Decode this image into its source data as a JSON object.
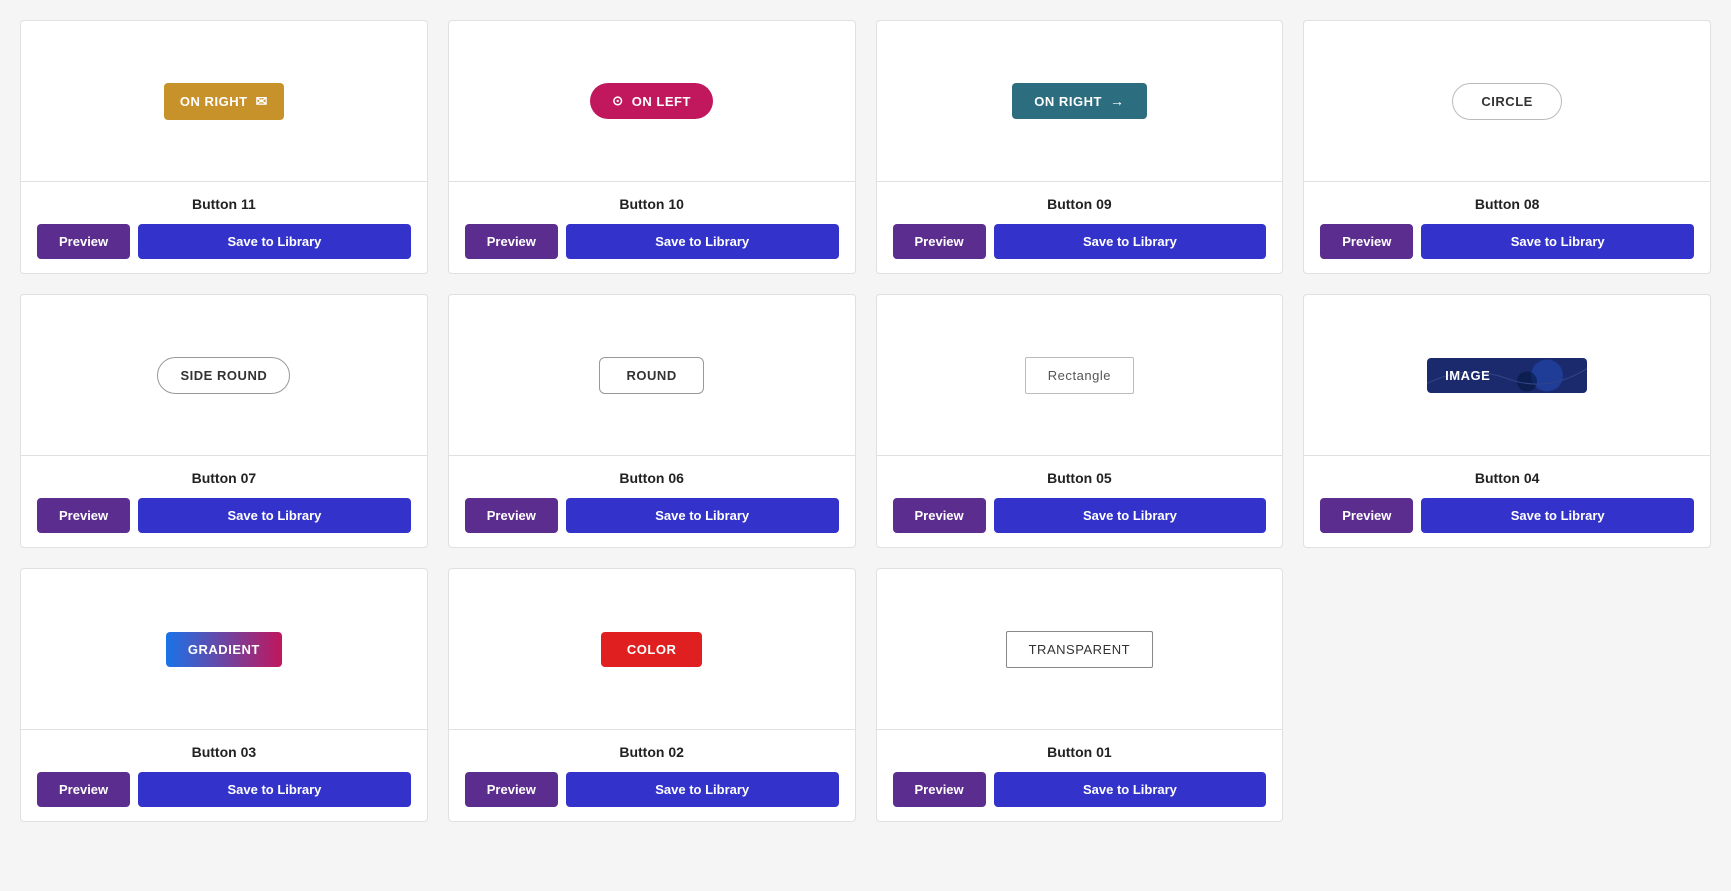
{
  "cards": [
    {
      "id": "btn11",
      "title": "Button 11",
      "demo_label": "ON RIGHT",
      "demo_type": "on-right",
      "preview_label": "Preview",
      "save_label": "Save to Library"
    },
    {
      "id": "btn10",
      "title": "Button 10",
      "demo_label": "ON LEFT",
      "demo_type": "on-left",
      "preview_label": "Preview",
      "save_label": "Save to Library"
    },
    {
      "id": "btn09",
      "title": "Button 09",
      "demo_label": "ON RIGHT",
      "demo_type": "on-right-arrow",
      "preview_label": "Preview",
      "save_label": "Save to Library"
    },
    {
      "id": "btn08",
      "title": "Button 08",
      "demo_label": "CIRCLE",
      "demo_type": "circle",
      "preview_label": "Preview",
      "save_label": "Save to Library"
    },
    {
      "id": "btn07",
      "title": "Button 07",
      "demo_label": "SIDE ROUND",
      "demo_type": "side-round",
      "preview_label": "Preview",
      "save_label": "Save to Library"
    },
    {
      "id": "btn06",
      "title": "Button 06",
      "demo_label": "ROUND",
      "demo_type": "round",
      "preview_label": "Preview",
      "save_label": "Save to Library"
    },
    {
      "id": "btn05",
      "title": "Button 05",
      "demo_label": "Rectangle",
      "demo_type": "rectangle",
      "preview_label": "Preview",
      "save_label": "Save to Library"
    },
    {
      "id": "btn04",
      "title": "Button 04",
      "demo_label": "IMAGE",
      "demo_type": "image",
      "preview_label": "Preview",
      "save_label": "Save to Library"
    },
    {
      "id": "btn03",
      "title": "Button 03",
      "demo_label": "GRADIENT",
      "demo_type": "gradient",
      "preview_label": "Preview",
      "save_label": "Save to Library"
    },
    {
      "id": "btn02",
      "title": "Button 02",
      "demo_label": "COLOR",
      "demo_type": "color",
      "preview_label": "Preview",
      "save_label": "Save to Library"
    },
    {
      "id": "btn01",
      "title": "Button 01",
      "demo_label": "TRANSPARENT",
      "demo_type": "transparent",
      "preview_label": "Preview",
      "save_label": "Save to Library"
    }
  ]
}
